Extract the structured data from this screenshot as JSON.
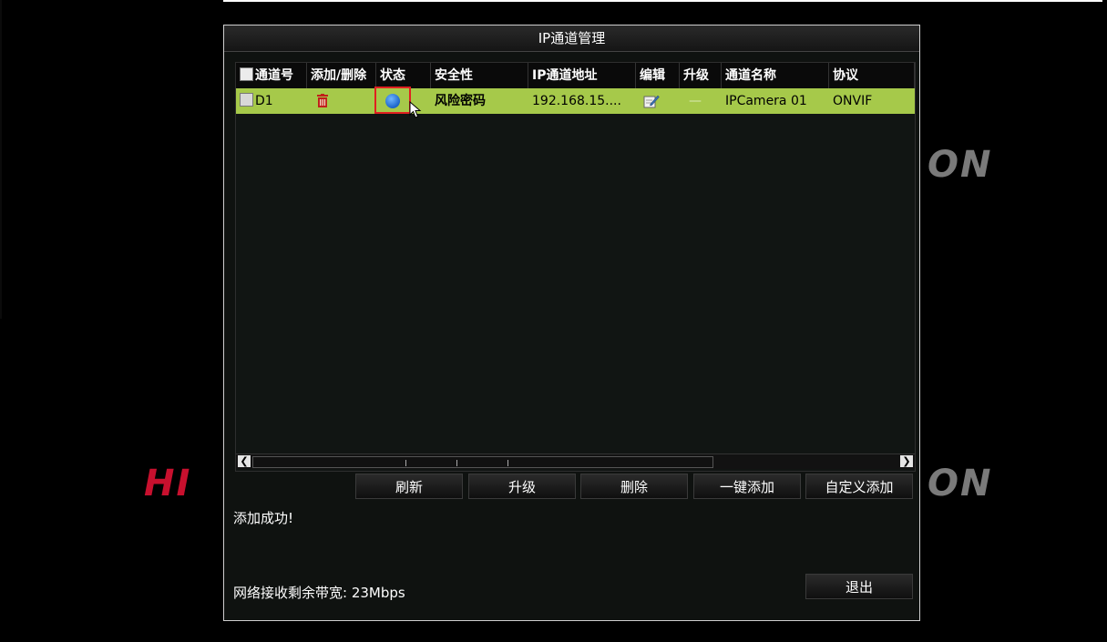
{
  "brand": {
    "left_text": "HI",
    "right_text": "ON",
    "color_left": "#c8102e",
    "color_right": "#7a7a7a"
  },
  "dialog": {
    "title": "IP通道管理",
    "table": {
      "columns": [
        "通道号",
        "添加/删除",
        "状态",
        "安全性",
        "IP通道地址",
        "编辑",
        "升级",
        "通道名称",
        "协议"
      ],
      "rows": [
        {
          "channel": "D1",
          "add_delete_icon": "trash-icon",
          "status_icon": "status-dot-icon",
          "status_color": "#1c64c8",
          "security": "风险密码",
          "ip": "192.168.15....",
          "edit_icon": "edit-icon",
          "upgrade": "—",
          "name": "IPCamera 01",
          "protocol": "ONVIF"
        }
      ],
      "selected_row_color": "#a6c94a"
    },
    "buttons": {
      "refresh": "刷新",
      "upgrade": "升级",
      "delete": "删除",
      "one_key_add": "一键添加",
      "custom_add": "自定义添加",
      "exit": "退出"
    },
    "message": "添加成功!",
    "bandwidth": "网络接收剩余带宽: 23Mbps"
  }
}
